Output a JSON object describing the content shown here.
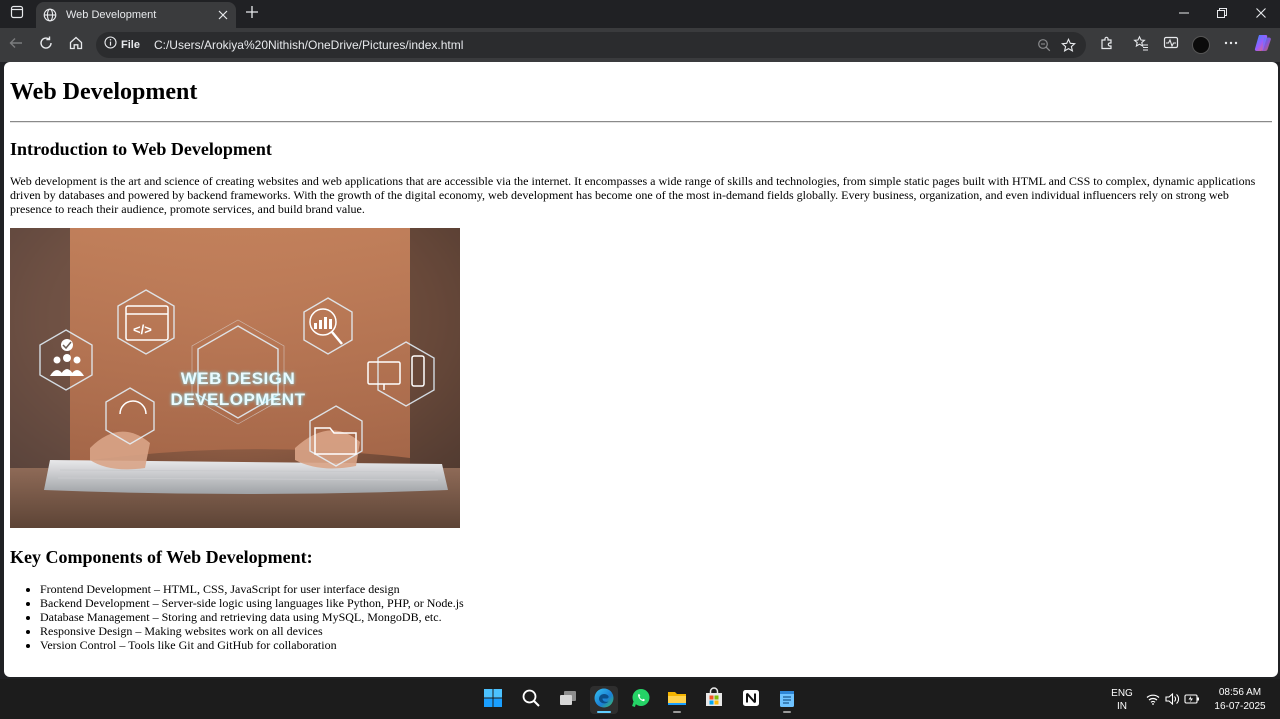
{
  "browser": {
    "tab": {
      "title": "Web Development"
    },
    "addressbar": {
      "site_info_label": "File",
      "url": "C:/Users/Arokiya%20Nithish/OneDrive/Pictures/index.html"
    }
  },
  "page": {
    "title": "Web Development",
    "intro_heading": "Introduction to Web Development",
    "intro_paragraph": "Web development is the art and science of creating websites and web applications that are accessible via the internet. It encompasses a wide range of skills and technologies, from simple static pages built with HTML and CSS to complex, dynamic applications driven by databases and powered by backend frameworks. With the growth of the digital economy, web development has become one of the most in-demand fields globally. Every business, organization, and even individual influencers rely on strong web presence to reach their audience, promote services, and build brand value.",
    "image": {
      "overlay_line1": "WEB DESIGN",
      "overlay_line2": "DEVELOPMENT"
    },
    "components_heading": "Key Components of Web Development:",
    "components": [
      "Frontend Development – HTML, CSS, JavaScript for user interface design",
      "Backend Development – Server-side logic using languages like Python, PHP, or Node.js",
      "Database Management – Storing and retrieving data using MySQL, MongoDB, etc.",
      "Responsive Design – Making websites work on all devices",
      "Version Control – Tools like Git and GitHub for collaboration"
    ]
  },
  "taskbar": {
    "apps": [
      "windows-start",
      "search",
      "task-view",
      "edge",
      "whatsapp",
      "file-explorer",
      "microsoft-store",
      "notion",
      "notepad"
    ],
    "language_line1": "ENG",
    "language_line2": "IN",
    "time": "08:56 AM",
    "date": "16-07-2025"
  },
  "colors": {
    "accent": "#60cdff",
    "tab_active": "#3a3b3d",
    "page_background": "#ffffff"
  }
}
